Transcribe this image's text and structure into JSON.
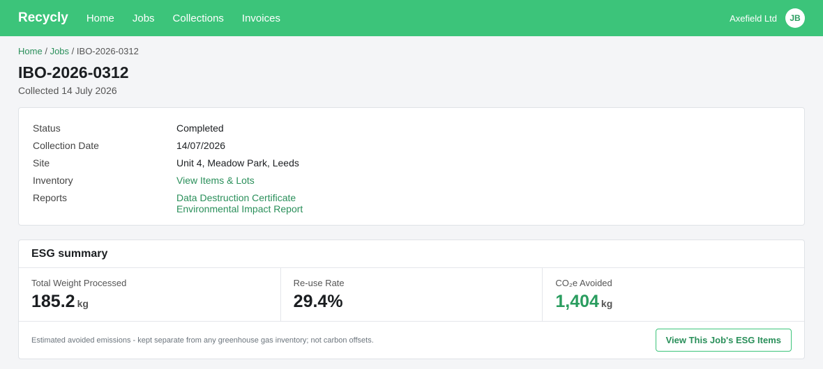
{
  "nav": {
    "brand": "Recycly",
    "links": [
      "Home",
      "Jobs",
      "Collections",
      "Invoices"
    ],
    "org": "Axefield Ltd",
    "avatar_initials": "JB"
  },
  "breadcrumb": {
    "home": "Home",
    "sep1": "/",
    "jobs": "Jobs",
    "sep2": "/",
    "current": "IBO-2026-0312"
  },
  "page": {
    "title": "IBO-2026-0312",
    "subtitle": "Collected 14 July 2026"
  },
  "details": {
    "rows": [
      {
        "label": "Status",
        "value": "Completed"
      },
      {
        "label": "Collection Date",
        "value": "14/07/2026"
      },
      {
        "label": "Site",
        "value": "Unit 4, Meadow Park, Leeds"
      },
      {
        "label": "Inventory",
        "value": "View Items & Lots"
      },
      {
        "label": "Reports",
        "links": [
          "Data Destruction Certificate",
          "Environmental Impact Report"
        ]
      }
    ]
  },
  "esg": {
    "title": "ESG summary",
    "metrics": [
      {
        "label": "Total Weight Processed",
        "value": "185.2",
        "unit": "kg"
      },
      {
        "label": "Re-use Rate",
        "value": "29.4%",
        "unit": ""
      },
      {
        "label": "CO₂e Avoided",
        "value": "1,404",
        "unit": "kg"
      }
    ],
    "footnote": "Estimated avoided emissions - kept separate from any greenhouse gas inventory; not carbon offsets.",
    "button_label": "View This Job's ESG Items"
  },
  "colors": {
    "brand_green": "#3cc47a",
    "link_green": "#2a8f5a",
    "highlight_green": "#2a9d5f"
  }
}
